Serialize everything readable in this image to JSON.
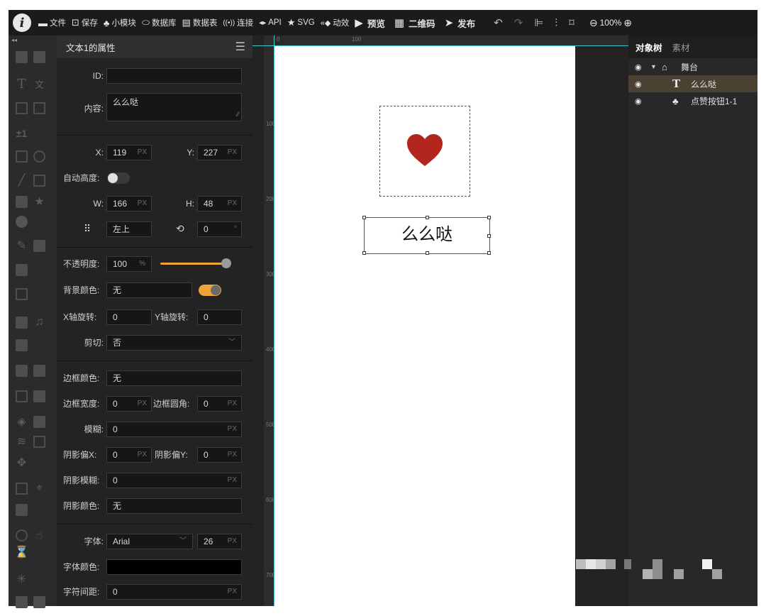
{
  "toolbar": {
    "items": [
      {
        "icon": "▬",
        "label": "文件"
      },
      {
        "icon": "⊡",
        "label": "保存"
      },
      {
        "icon": "♣",
        "label": "小模块"
      },
      {
        "icon": "⬭",
        "label": "数据库"
      },
      {
        "icon": "▤",
        "label": "数据表"
      },
      {
        "icon": "((•))",
        "label": "连接"
      },
      {
        "icon": "◂▸",
        "label": "API"
      },
      {
        "icon": "★",
        "label": "SVG"
      },
      {
        "icon": "«◆",
        "label": "动效"
      }
    ],
    "preview": "预览",
    "qrcode": "二维码",
    "publish": "发布",
    "zoom": "100%"
  },
  "props": {
    "title": "文本1的属性",
    "id_label": "ID:",
    "id_value": "",
    "content_label": "内容:",
    "content_value": "么么哒",
    "x_label": "X:",
    "x_value": "119",
    "y_label": "Y:",
    "y_value": "227",
    "unit_px": "PX",
    "autoheight_label": "自动高度:",
    "w_label": "W:",
    "w_value": "166",
    "h_label": "H:",
    "h_value": "48",
    "anchor_value": "左上",
    "rotate_value": "0",
    "unit_deg": "°",
    "opacity_label": "不透明度:",
    "opacity_value": "100",
    "unit_pct": "%",
    "opacity_level": 1.0,
    "bgcolor_label": "背景颜色:",
    "bgcolor_value": "无",
    "xrot_label": "X轴旋转:",
    "xrot_value": "0",
    "yrot_label": "Y轴旋转:",
    "yrot_value": "0",
    "clip_label": "剪切:",
    "clip_value": "否",
    "bordercolor_label": "边框颜色:",
    "bordercolor_value": "无",
    "borderwidth_label": "边框宽度:",
    "borderwidth_value": "0",
    "radius_label": "边框圆角:",
    "radius_value": "0",
    "blur_label": "模糊:",
    "blur_value": "0",
    "shx_label": "阴影偏X:",
    "shx_value": "0",
    "shy_label": "阴影偏Y:",
    "shy_value": "0",
    "shblur_label": "阴影模糊:",
    "shblur_value": "0",
    "shcolor_label": "阴影颜色:",
    "shcolor_value": "无",
    "font_label": "字体:",
    "font_value": "Arial",
    "fontsize_value": "26",
    "fontcolor_label": "字体颜色:",
    "fontcolor_value": "#000000",
    "spacing_label": "字符间距:",
    "spacing_value": "0"
  },
  "ruler": {
    "top": [
      "0",
      "100"
    ],
    "left": [
      "100",
      "200",
      "300",
      "400",
      "500",
      "600",
      "700"
    ]
  },
  "stage": {
    "text": "么么哒",
    "heart_color": "#b3261e"
  },
  "tree": {
    "tabs": [
      "对象树",
      "素材"
    ],
    "nodes": [
      {
        "label": "舞台"
      },
      {
        "label": "么么哒"
      },
      {
        "label": "点赞按钮1-1"
      }
    ]
  },
  "colors": {
    "accent": "#f0a23a",
    "guide": "#3fc9cf",
    "selected_row": "#4a4132"
  }
}
